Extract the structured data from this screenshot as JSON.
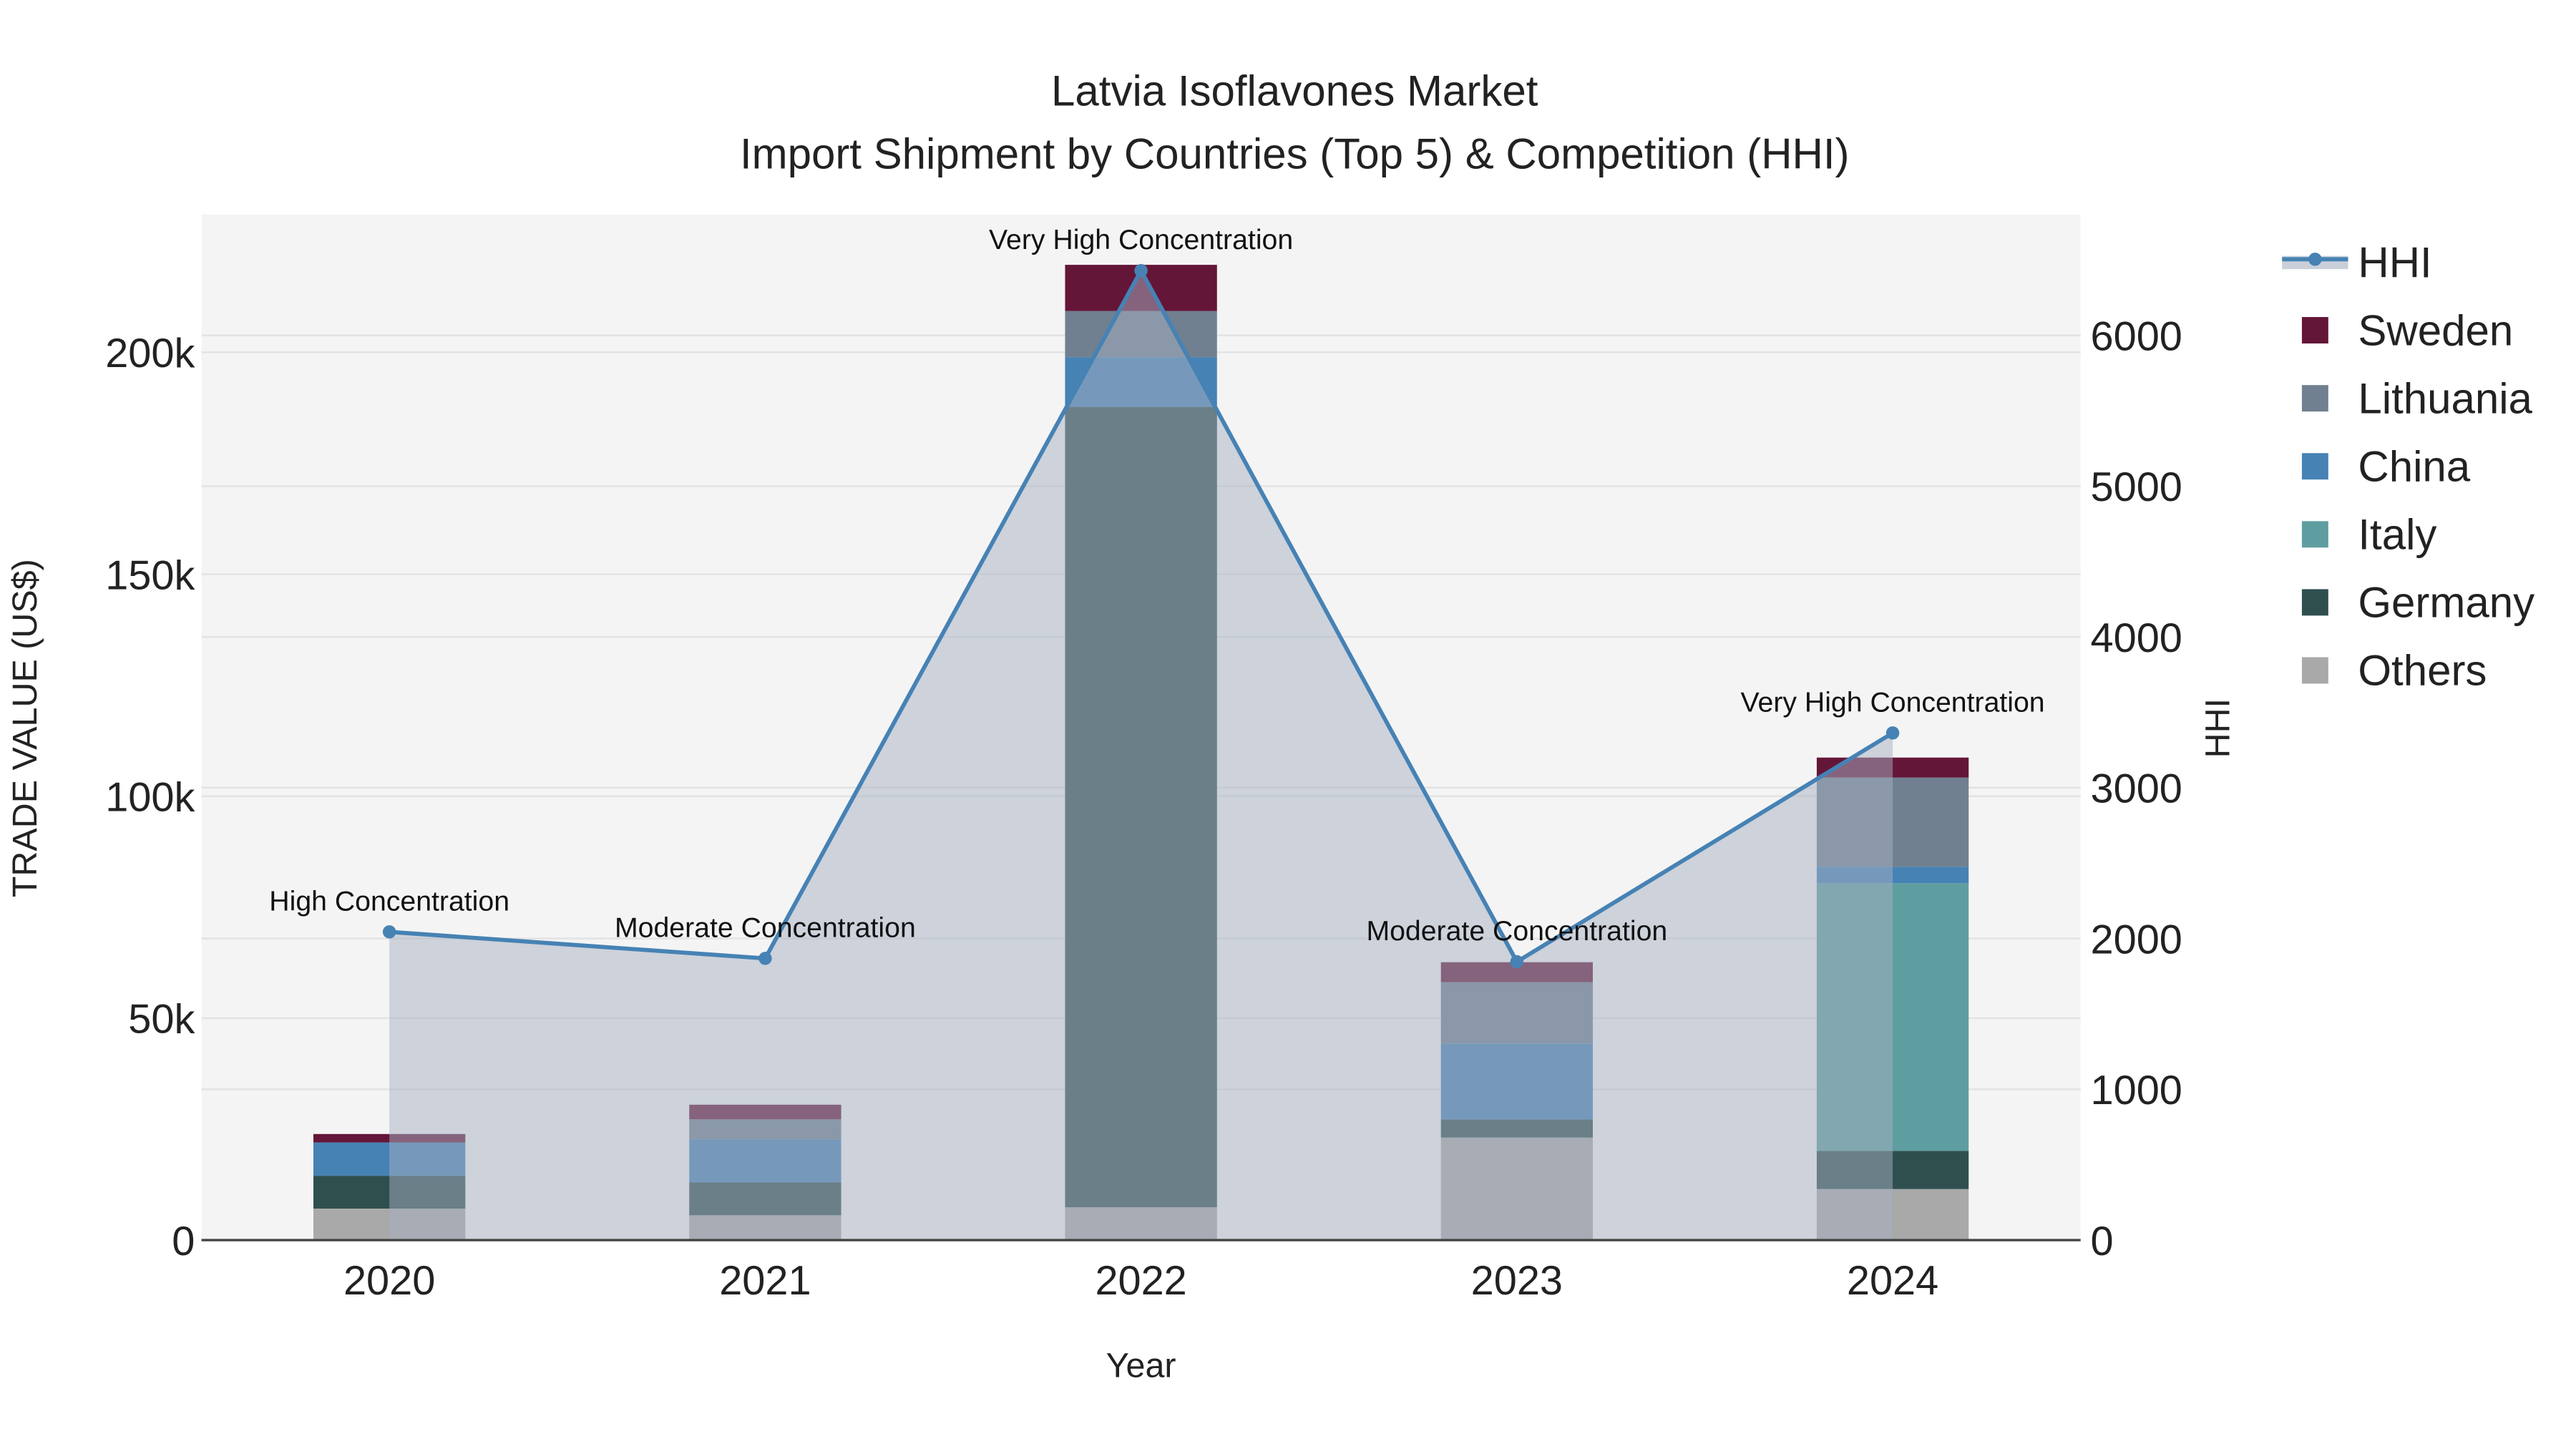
{
  "chart_data": {
    "type": "bar",
    "title": "Latvia Isoflavones Market",
    "subtitle": "Import Shipment by Countries (Top 5) & Competition (HHI)",
    "xlabel": "Year",
    "ylabel": "TRADE VALUE (US$)",
    "y2label": "HHI",
    "categories": [
      "2020",
      "2021",
      "2022",
      "2023",
      "2024"
    ],
    "ylim": [
      0,
      231000
    ],
    "y2lim": [
      0,
      6800
    ],
    "yticks": [
      {
        "v": 0,
        "label": "0"
      },
      {
        "v": 50000,
        "label": "50k"
      },
      {
        "v": 100000,
        "label": "100k"
      },
      {
        "v": 150000,
        "label": "150k"
      },
      {
        "v": 200000,
        "label": "200k"
      }
    ],
    "y2ticks": [
      {
        "v": 0,
        "label": "0"
      },
      {
        "v": 1000,
        "label": "1000"
      },
      {
        "v": 2000,
        "label": "2000"
      },
      {
        "v": 3000,
        "label": "3000"
      },
      {
        "v": 4000,
        "label": "4000"
      },
      {
        "v": 5000,
        "label": "5000"
      },
      {
        "v": 6000,
        "label": "6000"
      }
    ],
    "series": [
      {
        "name": "Others",
        "color": "#a9a9a9",
        "values": [
          7100,
          5600,
          7400,
          23100,
          11500
        ]
      },
      {
        "name": "Germany",
        "color": "#2f4f4f",
        "values": [
          7400,
          7400,
          180300,
          4100,
          8600
        ]
      },
      {
        "name": "Italy",
        "color": "#5f9ea0",
        "values": [
          0,
          0,
          0,
          0,
          60300
        ]
      },
      {
        "name": "China",
        "color": "#4682b4",
        "values": [
          7500,
          9700,
          11200,
          17100,
          3700
        ]
      },
      {
        "name": "Lithuania",
        "color": "#708090",
        "values": [
          0,
          4500,
          10400,
          13800,
          20100
        ]
      },
      {
        "name": "Sweden",
        "color": "#641638",
        "values": [
          1900,
          3300,
          10400,
          4500,
          4500
        ]
      }
    ],
    "hhi": {
      "name": "HHI",
      "color": "#4682b4",
      "values": [
        2044,
        1868,
        6429,
        1846,
        3363
      ]
    },
    "annotations": [
      "High Concentration",
      "Moderate Concentration",
      "Very High Concentration",
      "Moderate Concentration",
      "Very High Concentration"
    ],
    "legend": [
      "HHI",
      "Sweden",
      "Lithuania",
      "China",
      "Italy",
      "Germany",
      "Others"
    ],
    "legend_position": "right",
    "grid": true
  }
}
